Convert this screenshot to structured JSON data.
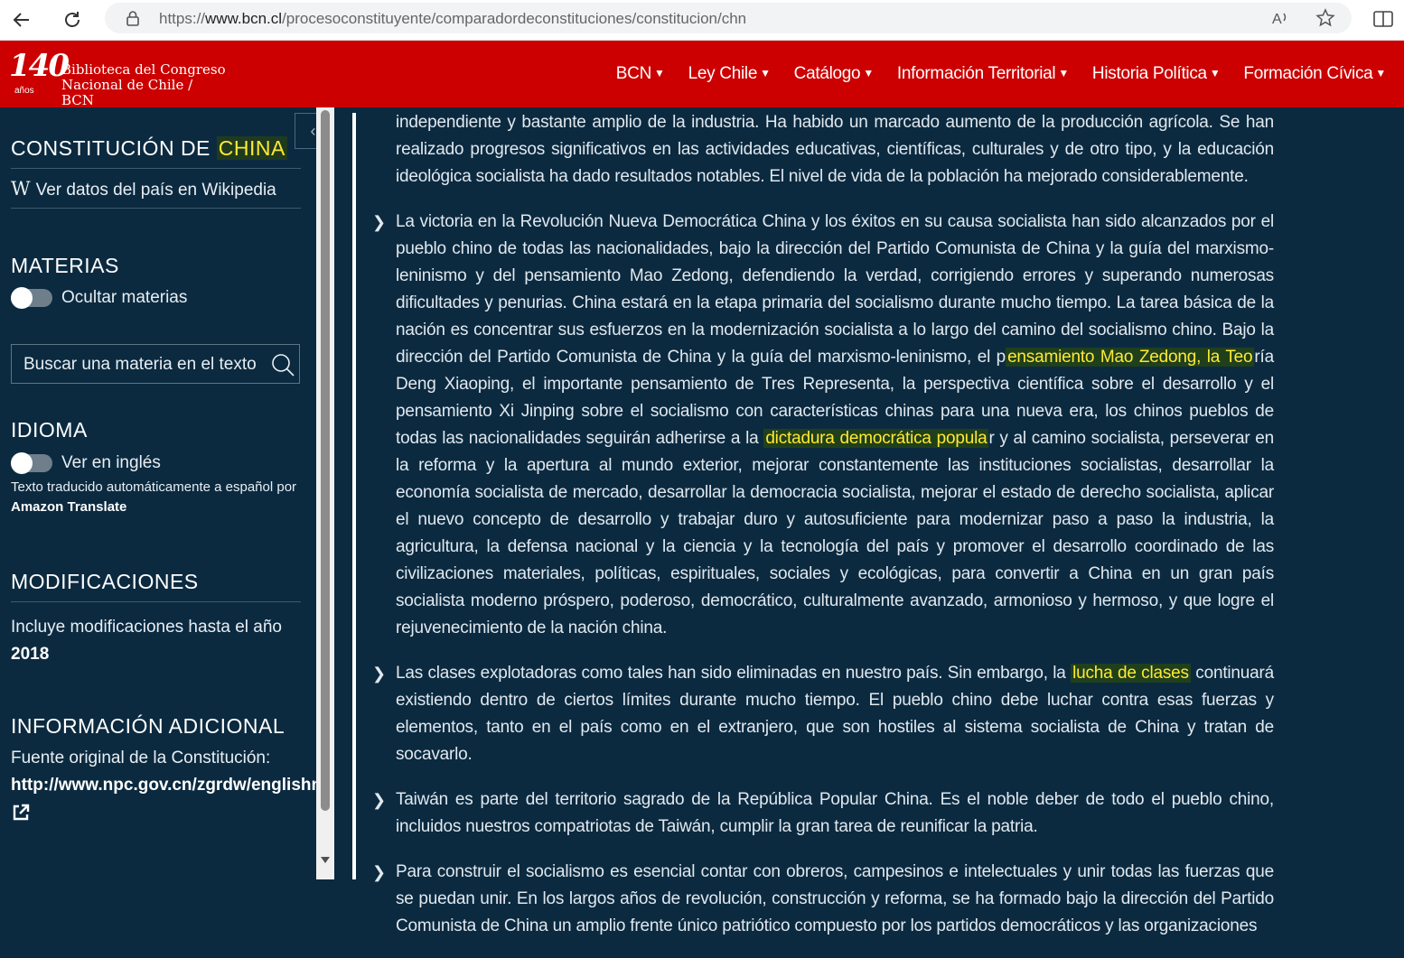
{
  "browser": {
    "url_prefix": "https://",
    "url_domain": "www.bcn.cl",
    "url_path": "/procesoconstituyente/comparadordeconstituciones/constitucion/chn"
  },
  "header": {
    "logo_number": "140",
    "logo_anos": "años",
    "logo_line1": "Biblioteca del Congreso",
    "logo_line2": "Nacional de Chile / BCN",
    "nav": [
      "BCN",
      "Ley Chile",
      "Catálogo",
      "Información Territorial",
      "Historia Política",
      "Formación Cívica"
    ]
  },
  "sidebar": {
    "title_prefix": "CONSTITUCIÓN DE",
    "title_country": "CHINA",
    "wiki_link": "Ver datos del país en Wikipedia",
    "materias_title": "MATERIAS",
    "ocultar_label": "Ocultar materias",
    "search_placeholder": "Buscar una materia en el texto",
    "idioma_title": "IDIOMA",
    "ingles_label": "Ver en inglés",
    "translate_note": "Texto traducido automáticamente a español por",
    "translate_provider": "Amazon Translate",
    "modificaciones_title": "MODIFICACIONES",
    "modificaciones_text": "Incluye modificaciones hasta el año",
    "modificaciones_year": "2018",
    "info_title": "INFORMACIÓN ADICIONAL",
    "fuente_label": "Fuente original de la Constitución:",
    "fuente_url": "http://www.npc.gov.cn/zgrdw/englishnpc/Constitution"
  },
  "content": {
    "p0": "independiente y bastante amplio de la industria. Ha habido un marcado aumento de la producción agrícola. Se han realizado progresos significativos en las actividades educativas, científicas, culturales y de otro tipo, y la educación ideológica socialista ha dado resultados notables. El nivel de vida de la población ha mejorado considerablemente.",
    "p1a": "La victoria en la Revolución Nueva Democrática China y los éxitos en su causa socialista han sido alcanzados por el pueblo chino de todas las nacionalidades, bajo la dirección del Partido Comunista de China y la guía del marxismo-leninismo y del pensamiento Mao Zedong, defendiendo la verdad, corrigiendo errores y superando numerosas dificultades y penurias. China estará en la etapa primaria del socialismo durante mucho tiempo. La tarea básica de la nación es concentrar sus esfuerzos en la modernización socialista a lo largo del camino del socialismo chino. Bajo la dirección del Partido Comunista de China y la guía del marxismo-leninismo, el p",
    "p1_hl1": "ensamiento Mao Zedong, la Teo",
    "p1b": "ría Deng Xiaoping, el importante pensamiento de Tres Representa, la perspectiva científica sobre el desarrollo y el pensamiento Xi Jinping sobre el socialismo con características chinas para una nueva era, los chinos pueblos de todas las nacionalidades seguirán adherirse a la ",
    "p1_hl2": "dictadura democrática popula",
    "p1c": "r y al camino socialista, perseverar en la reforma y la apertura al mundo exterior, mejorar constantemente las instituciones socialistas, desarrollar la economía socialista de mercado, desarrollar la democracia socialista, mejorar el estado de derecho socialista, aplicar el nuevo concepto de desarrollo y trabajar duro y autosuficiente para modernizar paso a paso la industria, la agricultura, la defensa nacional y la ciencia y la tecnología del país y promover el desarrollo coordinado de las civilizaciones materiales, políticas, espirituales, sociales y ecológicas, para convertir a China en un gran país socialista moderno próspero, poderoso, democrático, culturalmente avanzado, armonioso y hermoso, y que logre el rejuvenecimiento de la nación china.",
    "p2a": "Las clases explotadoras como tales han sido eliminadas en nuestro país. Sin embargo, la ",
    "p2_hl": "lucha de clases",
    "p2b": " continuará existiendo dentro de ciertos límites durante mucho tiempo. El pueblo chino debe luchar contra esas fuerzas y elementos, tanto en el país como en el extranjero, que son hostiles al sistema socialista de China y tratan de socavarlo.",
    "p3": "Taiwán es parte del territorio sagrado de la República Popular China. Es el noble deber de todo el pueblo chino, incluidos nuestros compatriotas de Taiwán, cumplir la gran tarea de reunificar la patria.",
    "p4": "Para construir el socialismo es esencial contar con obreros, campesinos e intelectuales y unir todas las fuerzas que se puedan unir. En los largos años de revolución, construcción y reforma, se ha formado bajo la dirección del Partido Comunista de China un amplio frente único patriótico compuesto por los partidos democráticos y las organizaciones"
  },
  "colors": {
    "header_red": "#cc0000",
    "page_navy": "#0b2a40",
    "highlight_yellow": "#ffe933"
  }
}
